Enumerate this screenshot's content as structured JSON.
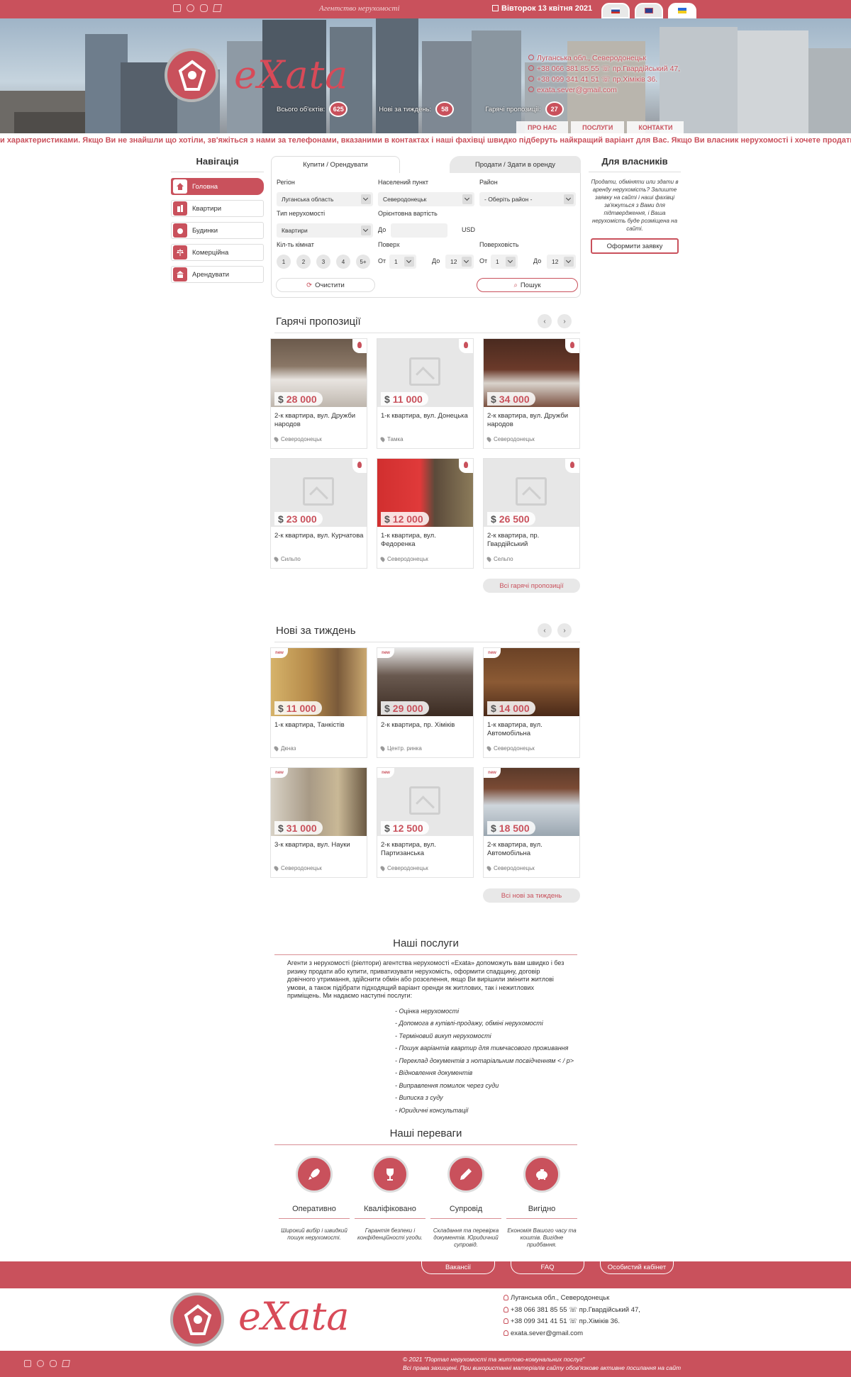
{
  "topbar": {
    "tagline": "Агентство нерухомості",
    "date": "Вівторок 13 квітня 2021",
    "socials": [
      "facebook-icon",
      "whatsapp-icon",
      "instagram-icon",
      "telegram-icon"
    ],
    "languages": [
      "ru",
      "en",
      "ua"
    ]
  },
  "brand": {
    "logo_text": "eXata",
    "accent": "#c9515c"
  },
  "hero": {
    "contacts": [
      "Луганська обл., Северодонецьк",
      "+38 066 381 85 55 ☏ пр.Гвардійський 47,",
      "+38 099 341 41 51 ☏ пр.Хіміків 36.",
      "exata.sever@gmail.com"
    ],
    "stats": [
      {
        "label": "Всього об'єктів:",
        "value": "625"
      },
      {
        "label": "Нові за тиждень:",
        "value": "58"
      },
      {
        "label": "Гарячі пропозиції:",
        "value": "27"
      }
    ],
    "menu": [
      "ПРО НАС",
      "ПОСЛУГИ",
      "КОНТАКТИ"
    ]
  },
  "marquee": "и характеристиками. Якщо Ви не знайшли що хотіли, зв'яжіться з нами за телефонами, вказаними в контактах і наші фахівці швидко підберуть найкращий варіант для Вас. Якщо Ви власник нерухомості і хочете продати, обміняти або здати в оренду св",
  "nav": {
    "title": "Навігація",
    "items": [
      {
        "label": "Головна",
        "icon": "home-icon"
      },
      {
        "label": "Квартири",
        "icon": "apartment-icon"
      },
      {
        "label": "Будинки",
        "icon": "house-icon"
      },
      {
        "label": "Комерційна",
        "icon": "scales-icon"
      },
      {
        "label": "Арендувати",
        "icon": "rent-icon"
      }
    ]
  },
  "search": {
    "tab_buy": "Купити / Орендувати",
    "tab_sell": "Продати / Здати в оренду",
    "region_label": "Регіон",
    "region_value": "Луганська область",
    "city_label": "Населений пункт",
    "city_value": "Северодонецьк",
    "district_label": "Район",
    "district_value": "- Оберіть район -",
    "type_label": "Тип нерухомості",
    "type_value": "Квартири",
    "price_label": "Орієнтовна вартість",
    "price_to": "До",
    "currency": "USD",
    "rooms_label": "Кіл-ть кімнат",
    "rooms": [
      "1",
      "2",
      "3",
      "4",
      "5+"
    ],
    "floor_label": "Поверх",
    "floors_label": "Поверховість",
    "from": "От",
    "to": "До",
    "floor_from": "1",
    "floor_to": "12",
    "floors_from": "1",
    "floors_to": "12",
    "clear": "Очистити",
    "submit": "Пошук"
  },
  "owners": {
    "title": "Для власників",
    "text": "Продати, обміняти или здати в аренду нерухомість? Залиште заявку на сайті і наші фахівці зв'яжуться з Вами для підтвердження, і Ваша нерухомість буде розміщена на сайті.",
    "button": "Оформити заявку"
  },
  "hot": {
    "title": "Гарячі пропозиції",
    "more": "Всі гарячі пропозиції",
    "cards": [
      {
        "price": "28 000",
        "title": "2-к квартира, вул. Дружби народов",
        "location": "Северодонецьк",
        "photo": "room"
      },
      {
        "price": "11 000",
        "title": "1-к квартира, вул. Донецька",
        "location": "Тамка",
        "photo": "none"
      },
      {
        "price": "34 000",
        "title": "2-к квартира, вул. Дружби народов",
        "location": "Северодонецьк",
        "photo": "kitchen"
      },
      {
        "price": "23 000",
        "title": "2-к квартира, вул. Курчатова",
        "location": "Сильпо",
        "photo": "none"
      },
      {
        "price": "12 000",
        "title": "1-к квартира, вул. Федоренка",
        "location": "Северодонецьк",
        "photo": "red"
      },
      {
        "price": "26 500",
        "title": "2-к квартира, пр. Гвардійський",
        "location": "Сельпо",
        "photo": "none"
      }
    ]
  },
  "new": {
    "title": "Нові за тиждень",
    "more": "Всі нові за тиждень",
    "badge": "new",
    "cards": [
      {
        "price": "11 000",
        "title": "1-к квартира, Танкістів",
        "location": "Дкназ",
        "photo": "wood"
      },
      {
        "price": "29 000",
        "title": "2-к квартира, пр. Хіміків",
        "location": "Центр. ринка",
        "photo": "dark"
      },
      {
        "price": "14 000",
        "title": "1-к квартира, вул. Автомобільна",
        "location": "Северодонецьк",
        "photo": "brown"
      },
      {
        "price": "31 000",
        "title": "3-к квартира, вул. Науки",
        "location": "Северодонецьк",
        "photo": "curtain"
      },
      {
        "price": "12 500",
        "title": "2-к квартира, вул. Партизанська",
        "location": "Северодонецьк",
        "photo": "none"
      },
      {
        "price": "18 500",
        "title": "2-к квартира, вул. Автомобільна",
        "location": "Северодонецьк",
        "photo": "tile"
      }
    ]
  },
  "services": {
    "title": "Наші послуги",
    "intro": "Агенти з нерухомості (ріелтори) агентства нерухомості «Exata» допоможуть вам швидко і без ризику продати або купити, приватизувати нерухомість, оформити спадщину, договір довічного утримання, здійснити обмін або розселення, якщо Ви вирішили змінити житлові умови, а також підібрати підходящий варіант оренди як житлових, так і нежитлових приміщень. Ми надаємо наступні послуги:",
    "items": [
      "- Оцінка нерухомості",
      "- Допомога в купівлі-продажу, обміні нерухомості",
      "- Терміновий викуп нерухомості",
      "- Пошук варіантів квартир для тимчасового проживання",
      "- Переклад документів з нотаріальним посвідченням < / p>",
      "- Відновлення документів",
      "- Виправлення помилок через суди",
      "- Виписка з суду",
      "- Юридичні консультації"
    ]
  },
  "advantages": {
    "title": "Наші переваги",
    "items": [
      {
        "name": "Оперативно",
        "desc": "Широкий вибір і швидкий пошук нерухомості.",
        "icon": "rocket-icon"
      },
      {
        "name": "Кваліфіковано",
        "desc": "Гарантія безпеки і конфіденційності угоди.",
        "icon": "trophy-icon"
      },
      {
        "name": "Супровід",
        "desc": "Складання та перевірка документів. Юридичний супровід.",
        "icon": "pencil-icon"
      },
      {
        "name": "Вигідно",
        "desc": "Економія Вашого часу та коштів. Вигідне придбання.",
        "icon": "piggy-bank-icon"
      }
    ]
  },
  "footer": {
    "links": [
      "Вакансії",
      "FAQ",
      "Особистий кабінет"
    ],
    "contacts": [
      "Луганська обл., Северодонецьк",
      "+38 066 381 85 55 ☏ пр.Гвардійський 47,",
      "+38 099 341 41 51 ☏ пр.Хіміків 36.",
      "exata.sever@gmail.com"
    ],
    "copyright": "© 2021 \"Портал нерухомості та житлово-комунальних послуг\"",
    "rights": "Всі права захищені. При використанні матеріалів сайту обов'язкове активне посилання на сайт"
  }
}
